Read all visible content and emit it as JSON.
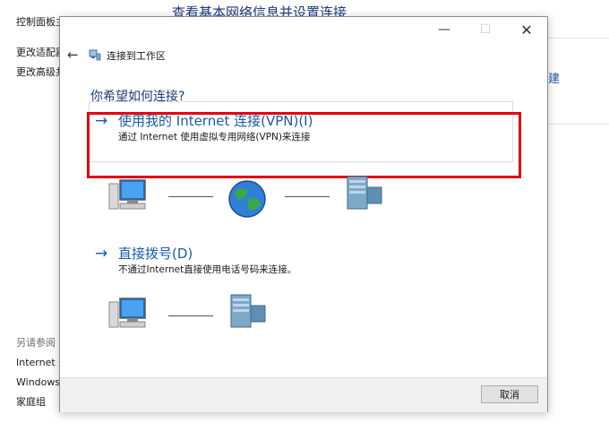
{
  "background": {
    "heading": "查看基本网络信息并设置连接",
    "left_items": [
      "控制面板主页",
      "更改适配器",
      "更改高级共"
    ],
    "see_also": "另请参阅",
    "see_also_items": [
      "Internet 选项",
      "Windows 防",
      "家庭组"
    ],
    "right_link": "建"
  },
  "dialog": {
    "nav_title": "连接到工作区",
    "question": "你希望如何连接?",
    "options": [
      {
        "title": "使用我的 Internet 连接(VPN)(I)",
        "desc": "通过 Internet 使用虚拟专用网络(VPN)来连接"
      },
      {
        "title": "直接拨号(D)",
        "desc": "不通过Internet直接使用电话号码来连接。"
      }
    ],
    "cancel_label": "取消"
  },
  "colors": {
    "accent": "#1a5aa8",
    "highlight": "#e3000f",
    "heading": "#1b3a78"
  }
}
